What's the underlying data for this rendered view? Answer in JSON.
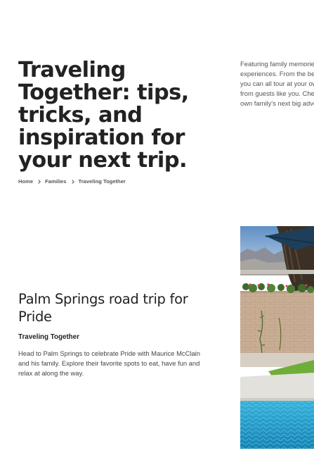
{
  "hero": {
    "title_lines": [
      "Traveling",
      "Together: tips,",
      "tricks, and",
      "inspiration for",
      "your next trip."
    ],
    "intro_lines": [
      "Featuring family memories",
      "experiences. From the best",
      "you can all tour at your ow",
      "from guests like you. Check",
      "own family's next big adver"
    ]
  },
  "breadcrumb": {
    "items": [
      "Home",
      "Families",
      "Traveling Together"
    ]
  },
  "card": {
    "title_lines": [
      "Palm Springs road trip for",
      "Pride"
    ],
    "category": "Traveling Together",
    "description_lines": [
      "Head to Palm Springs to celebrate Pride with Maurice McClain",
      "and his family. Explore their favorite spots to eat, have fun and",
      "relax at along the way."
    ]
  },
  "colors": {
    "text": "#222222",
    "muted": "#555555",
    "pool": "#1e9cc9",
    "sky": "#a9c8e3"
  }
}
